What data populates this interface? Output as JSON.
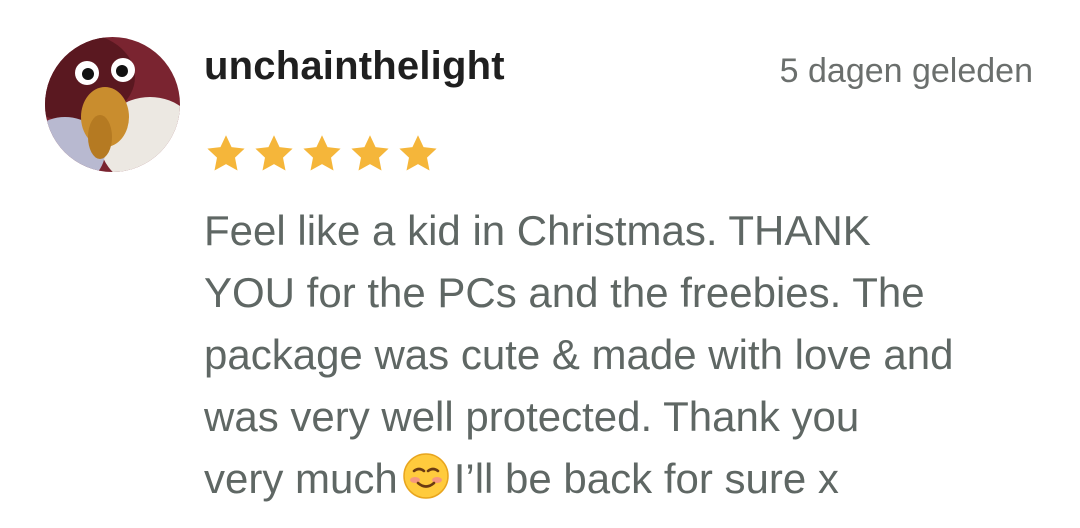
{
  "review": {
    "username": "unchainthelight",
    "timestamp": "5 dagen geleden",
    "rating": 5,
    "rating_max": 5,
    "star_color": "#F5B63A",
    "text_lines": [
      "Feel like a kid in Christmas. THANK",
      "YOU for the PCs and the freebies. The",
      "package was cute & made with love and",
      "was very well protected. Thank you"
    ],
    "last_line_before_emoji": "very much",
    "emoji": "smiling-face-emoji",
    "last_line_after_emoji": "I’ll be back for sure x"
  }
}
